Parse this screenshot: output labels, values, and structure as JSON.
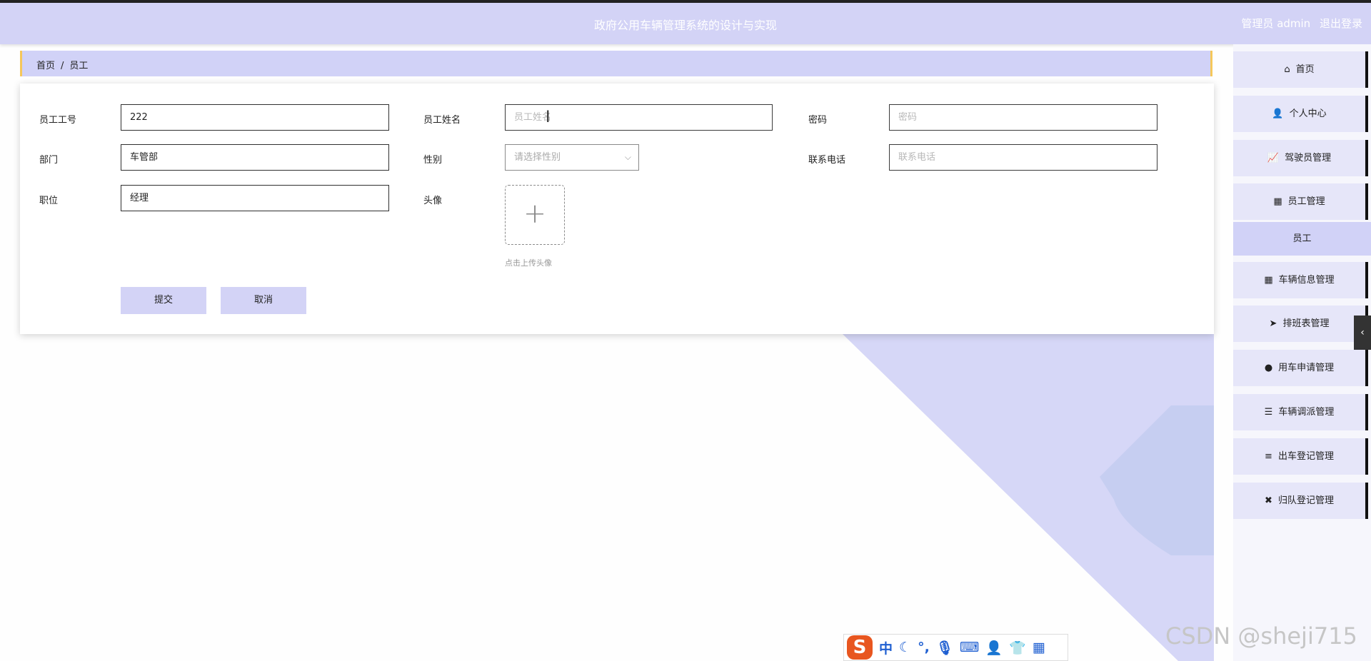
{
  "header": {
    "title": "政府公用车辆管理系统的设计与实现",
    "user_label": "管理员 admin",
    "logout_label": "退出登录"
  },
  "breadcrumb": {
    "home": "首页",
    "separator": "/",
    "current": "员工"
  },
  "form": {
    "employee_no": {
      "label": "员工工号",
      "value": "222"
    },
    "employee_name": {
      "label": "员工姓名",
      "placeholder": "员工姓名",
      "value": ""
    },
    "password": {
      "label": "密码",
      "placeholder": "密码",
      "value": ""
    },
    "department": {
      "label": "部门",
      "value": "车管部"
    },
    "gender": {
      "label": "性别",
      "placeholder": "请选择性别",
      "value": ""
    },
    "phone": {
      "label": "联系电话",
      "placeholder": "联系电话",
      "value": ""
    },
    "position": {
      "label": "职位",
      "value": "经理"
    },
    "avatar": {
      "label": "头像",
      "tip": "点击上传头像"
    },
    "submit_label": "提交",
    "cancel_label": "取消"
  },
  "sidebar": {
    "items": [
      {
        "label": "首页",
        "icon": "home-icon",
        "glyph": "⌂"
      },
      {
        "label": "个人中心",
        "icon": "user-icon",
        "glyph": "👤"
      },
      {
        "label": "驾驶员管理",
        "icon": "chart-icon",
        "glyph": "📈"
      },
      {
        "label": "员工管理",
        "icon": "grid-icon",
        "glyph": "▦"
      },
      {
        "label": "车辆信息管理",
        "icon": "grid-icon",
        "glyph": "▦"
      },
      {
        "label": "排班表管理",
        "icon": "send-icon",
        "glyph": "➤"
      },
      {
        "label": "用车申请管理",
        "icon": "bulb-icon",
        "glyph": "●"
      },
      {
        "label": "车辆调派管理",
        "icon": "list-icon",
        "glyph": "☰"
      },
      {
        "label": "出车登记管理",
        "icon": "align-icon",
        "glyph": "≡"
      },
      {
        "label": "归队登记管理",
        "icon": "ticket-icon",
        "glyph": "✖"
      }
    ],
    "active_sub": "员工"
  },
  "ime_toolbar": {
    "logo": "S",
    "mode": "中"
  },
  "watermark": "CSDN @sheji715"
}
